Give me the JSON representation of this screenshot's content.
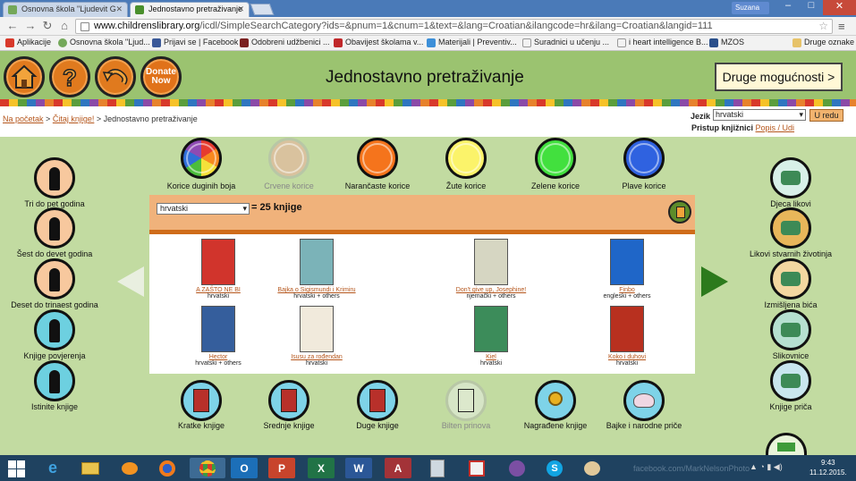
{
  "browser": {
    "tabs": [
      {
        "title": "Osnovna škola \"Ljudevit G",
        "active": false
      },
      {
        "title": "Jednostavno pretraživanje",
        "active": true
      }
    ],
    "user": "Suzana",
    "address": {
      "host": "www.childrenslibrary.org",
      "path": "/icdl/SimpleSearchCategory?ids=&pnum=1&cnum=1&text=&lang=Croatian&ilangcode=hr&ilang=Croatian&langid=111"
    },
    "bookmarks": [
      "Aplikacije",
      "Osnovna škola \"Ljud...",
      "Prijavi se | Facebook",
      "Odobreni udžbenici ...",
      "Obavijest školama v...",
      "Materijali | Preventiv...",
      "Suradnici u učenju ...",
      "i heart intelligence B...",
      "MZOS",
      "Druge oznake"
    ]
  },
  "header": {
    "title": "Jednostavno pretraživanje",
    "donate": "Donate Now",
    "more": "Druge mogućnosti >"
  },
  "nav": {
    "breadcrumb_home": "Na početak",
    "breadcrumb_read": "Čitaj knjige!",
    "breadcrumb_current": "Jednostavno pretraživanje",
    "sep": ">",
    "language_label": "Jezik",
    "language_value": "hrvatski",
    "go": "U redu",
    "access_label": "Pristup knjižnici",
    "access_link": "Popis / Udi"
  },
  "colors": [
    {
      "label": "Korice duginih boja",
      "fill": "rainbow"
    },
    {
      "label": "Crvene korice",
      "fill": "#d9c29e",
      "faded": true
    },
    {
      "label": "Narančaste korice",
      "fill": "#f5741c"
    },
    {
      "label": "Žute korice",
      "fill": "#fbf36a"
    },
    {
      "label": "Zelene korice",
      "fill": "#42e03e"
    },
    {
      "label": "Plave korice",
      "fill": "#2f62e0"
    }
  ],
  "left_categories": [
    "Tri do pet godina",
    "Šest do devet godina",
    "Deset do trinaest godina",
    "Knjige povjerenja",
    "Istinite knjige"
  ],
  "right_categories": [
    "Djeca likovi",
    "Likovi stvarnih životinja",
    "Izmišljena bića",
    "Slikovnice",
    "Knjige priča"
  ],
  "bottom_categories": [
    {
      "label": "Kratke knjige",
      "faded": false
    },
    {
      "label": "Srednje knjige",
      "faded": false
    },
    {
      "label": "Duge knjige",
      "faded": false
    },
    {
      "label": "Bilten prinova",
      "faded": true
    },
    {
      "label": "Nagrađene knjige",
      "faded": false
    },
    {
      "label": "Bajke i narodne priče",
      "faded": false
    }
  ],
  "results": {
    "language": "hrvatski",
    "count": "= 25 knjige",
    "books": [
      {
        "title": "A ZAŠTO NE BI",
        "lang": "hrvatski",
        "cover": "#d1342c"
      },
      {
        "title": "Bajka o Sigismundi i Krimiru",
        "lang": "hrvatski + others",
        "cover": "#7bb3b8"
      },
      {
        "title": "Don't give up, Josephine!",
        "lang": "njemački + others",
        "cover": "#d6d6c2"
      },
      {
        "title": "Finbo",
        "lang": "engleski + others",
        "cover": "#1f66c8"
      },
      {
        "title": "Hector",
        "lang": "hrvatski + others",
        "cover": "#355e9c"
      },
      {
        "title": "Isusu za rođendan",
        "lang": "hrvatski",
        "cover": "#f1eadc"
      },
      {
        "title": "Kiel",
        "lang": "hrvatski",
        "cover": "#3c8c5a"
      },
      {
        "title": "Koko i duhovi",
        "lang": "hrvatski",
        "cover": "#b8301f"
      }
    ]
  },
  "taskbar": {
    "watermark": "facebook.com/MarkNelsonPhoto",
    "time": "9:43",
    "date": "11.12.2015."
  }
}
